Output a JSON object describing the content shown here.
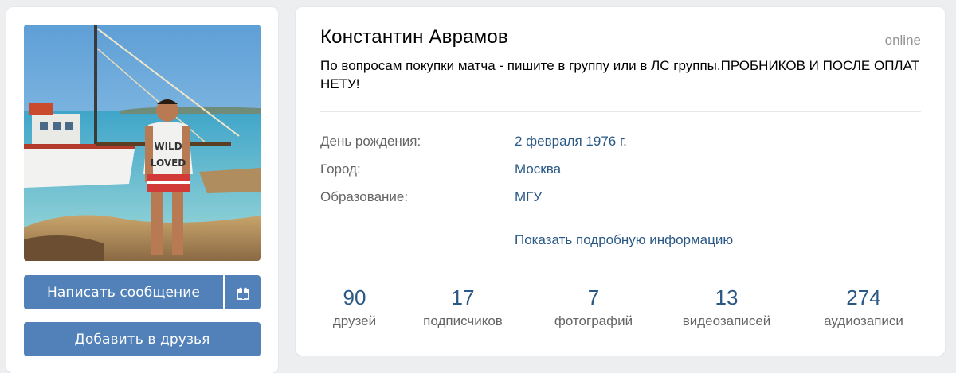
{
  "profile": {
    "name": "Константин Аврамов",
    "online_status": "online",
    "status_text": "По вопросам покупки матча - пишите в группу или в ЛС группы.ПРОБНИКОВ И ПОСЛЕ ОПЛАТ НЕТУ!",
    "avatar_shirt_text": [
      "WILD",
      "LOVED"
    ]
  },
  "actions": {
    "message_label": "Написать сообщение",
    "gift_icon": "gift-icon",
    "add_friend_label": "Добавить в друзья"
  },
  "info": {
    "rows": [
      {
        "label": "День рождения:",
        "value": "2 февраля 1976 г."
      },
      {
        "label": "Город:",
        "value": "Москва"
      },
      {
        "label": "Образование:",
        "value": "МГУ"
      }
    ],
    "more_link": "Показать подробную информацию"
  },
  "counters": [
    {
      "count": "90",
      "label": "друзей"
    },
    {
      "count": "17",
      "label": "подписчиков"
    },
    {
      "count": "7",
      "label": "фотографий"
    },
    {
      "count": "13",
      "label": "видеозаписей"
    },
    {
      "count": "274",
      "label": "аудиозаписи"
    }
  ],
  "colors": {
    "page_bg": "#edeef0",
    "button_bg": "#5181b8",
    "link": "#2a5885",
    "label_gray": "#656565"
  }
}
